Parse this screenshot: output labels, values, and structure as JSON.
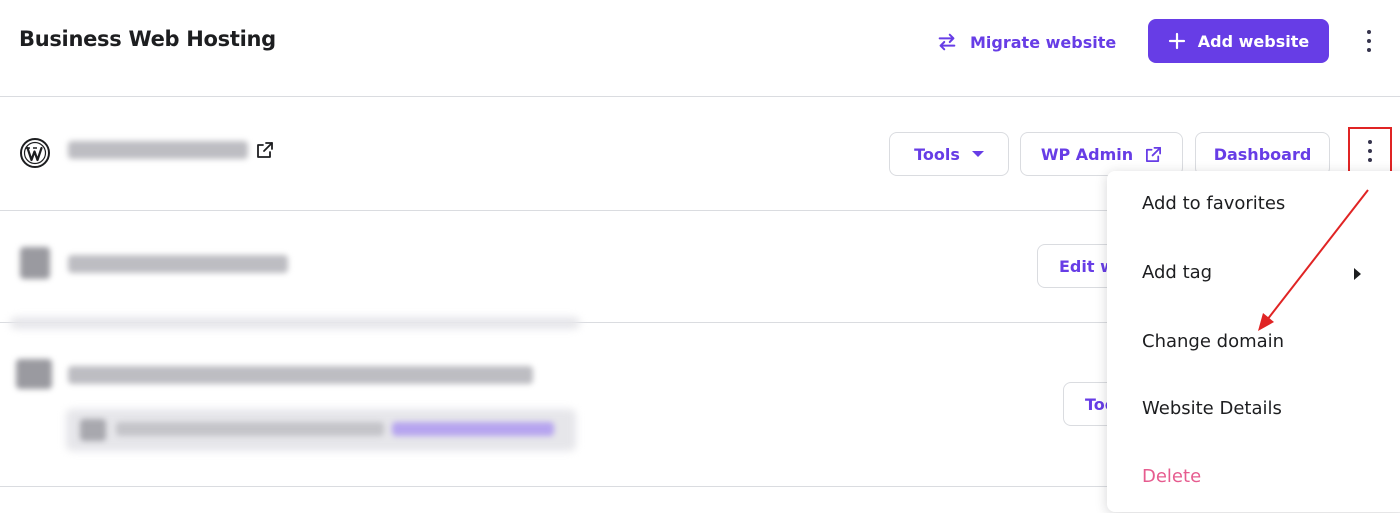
{
  "header": {
    "title": "Business Web Hosting",
    "migrate_label": "Migrate website",
    "add_label": "Add website"
  },
  "websites": [
    {
      "domain": "(blurred)",
      "buttons": {
        "tools": "Tools",
        "wp_admin": "WP Admin",
        "dashboard": "Dashboard"
      }
    },
    {
      "domain": "(blurred)",
      "buttons": {
        "edit": "Edit w"
      }
    },
    {
      "domain": "(blurred)",
      "buttons": {
        "tools": "Too"
      }
    }
  ],
  "context_menu": {
    "items": [
      "Add to favorites",
      "Add tag",
      "Change domain",
      "Website Details",
      "Delete"
    ]
  },
  "colors": {
    "accent": "#673de6",
    "danger": "#e65c8f",
    "annotation": "#e02424"
  }
}
